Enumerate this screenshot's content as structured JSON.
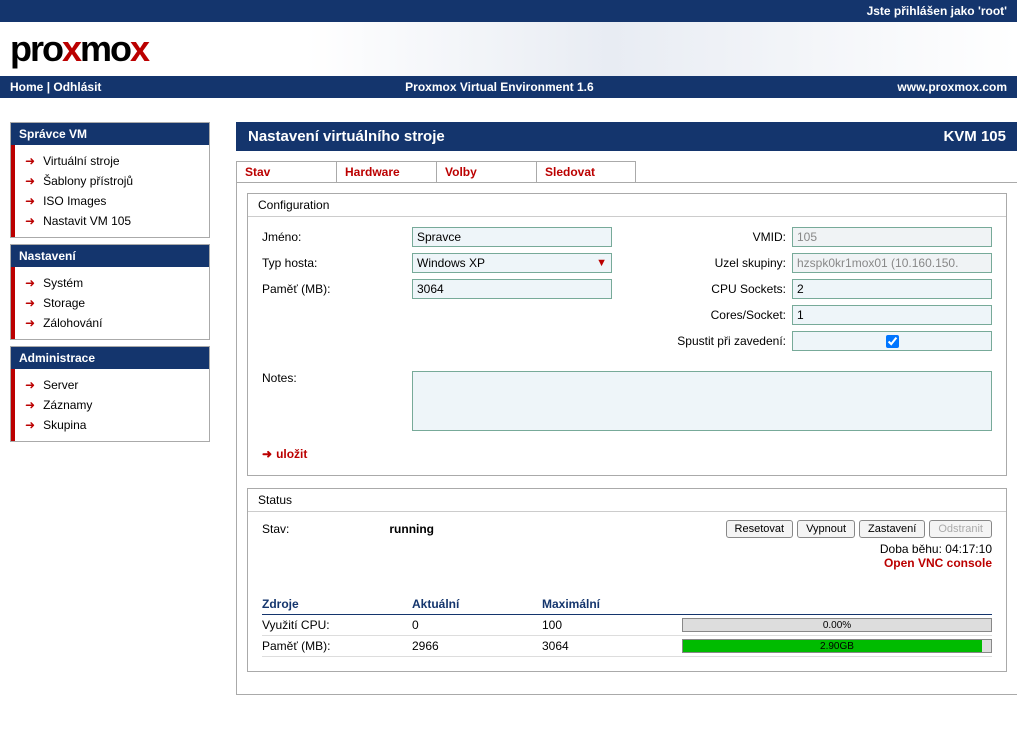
{
  "topbar": {
    "login_status": "Jste přihlášen jako 'root'"
  },
  "navbar": {
    "home": "Home",
    "logout": "Odhlásit",
    "title": "Proxmox Virtual Environment 1.6",
    "url": "www.proxmox.com"
  },
  "sidebar": {
    "sections": [
      {
        "title": "Správce VM",
        "items": [
          "Virtuální stroje",
          "Šablony přístrojů",
          "ISO Images",
          "Nastavit VM 105"
        ]
      },
      {
        "title": "Nastavení",
        "items": [
          "Systém",
          "Storage",
          "Zálohování"
        ]
      },
      {
        "title": "Administrace",
        "items": [
          "Server",
          "Záznamy",
          "Skupina"
        ]
      }
    ]
  },
  "page": {
    "title": "Nastavení virtuálního stroje",
    "badge": "KVM 105"
  },
  "tabs": [
    "Stav",
    "Hardware",
    "Volby",
    "Sledovat"
  ],
  "config": {
    "legend": "Configuration",
    "name_label": "Jméno:",
    "name_value": "Spravce",
    "guest_label": "Typ hosta:",
    "guest_value": "Windows XP",
    "memory_label": "Paměť (MB):",
    "memory_value": "3064",
    "vmid_label": "VMID:",
    "vmid_value": "105",
    "node_label": "Uzel skupiny:",
    "node_value": "hzspk0kr1mox01 (10.160.150.",
    "sockets_label": "CPU Sockets:",
    "sockets_value": "2",
    "cores_label": "Cores/Socket:",
    "cores_value": "1",
    "boot_label": "Spustit při zavedení:",
    "notes_label": "Notes:",
    "save": "uložit"
  },
  "status": {
    "legend": "Status",
    "state_label": "Stav:",
    "state_value": "running",
    "buttons": {
      "reset": "Resetovat",
      "shutdown": "Vypnout",
      "stop": "Zastavení",
      "remove": "Odstranit"
    },
    "uptime": "Doba běhu: 04:17:10",
    "vnc": "Open VNC console",
    "headers": {
      "resource": "Zdroje",
      "current": "Aktuální",
      "max": "Maximální"
    },
    "cpu": {
      "label": "Využití CPU:",
      "current": "0",
      "max": "100",
      "pct": 0,
      "text": "0.00%"
    },
    "mem": {
      "label": "Paměť (MB):",
      "current": "2966",
      "max": "3064",
      "pct": 97,
      "text": "2.90GB"
    }
  }
}
